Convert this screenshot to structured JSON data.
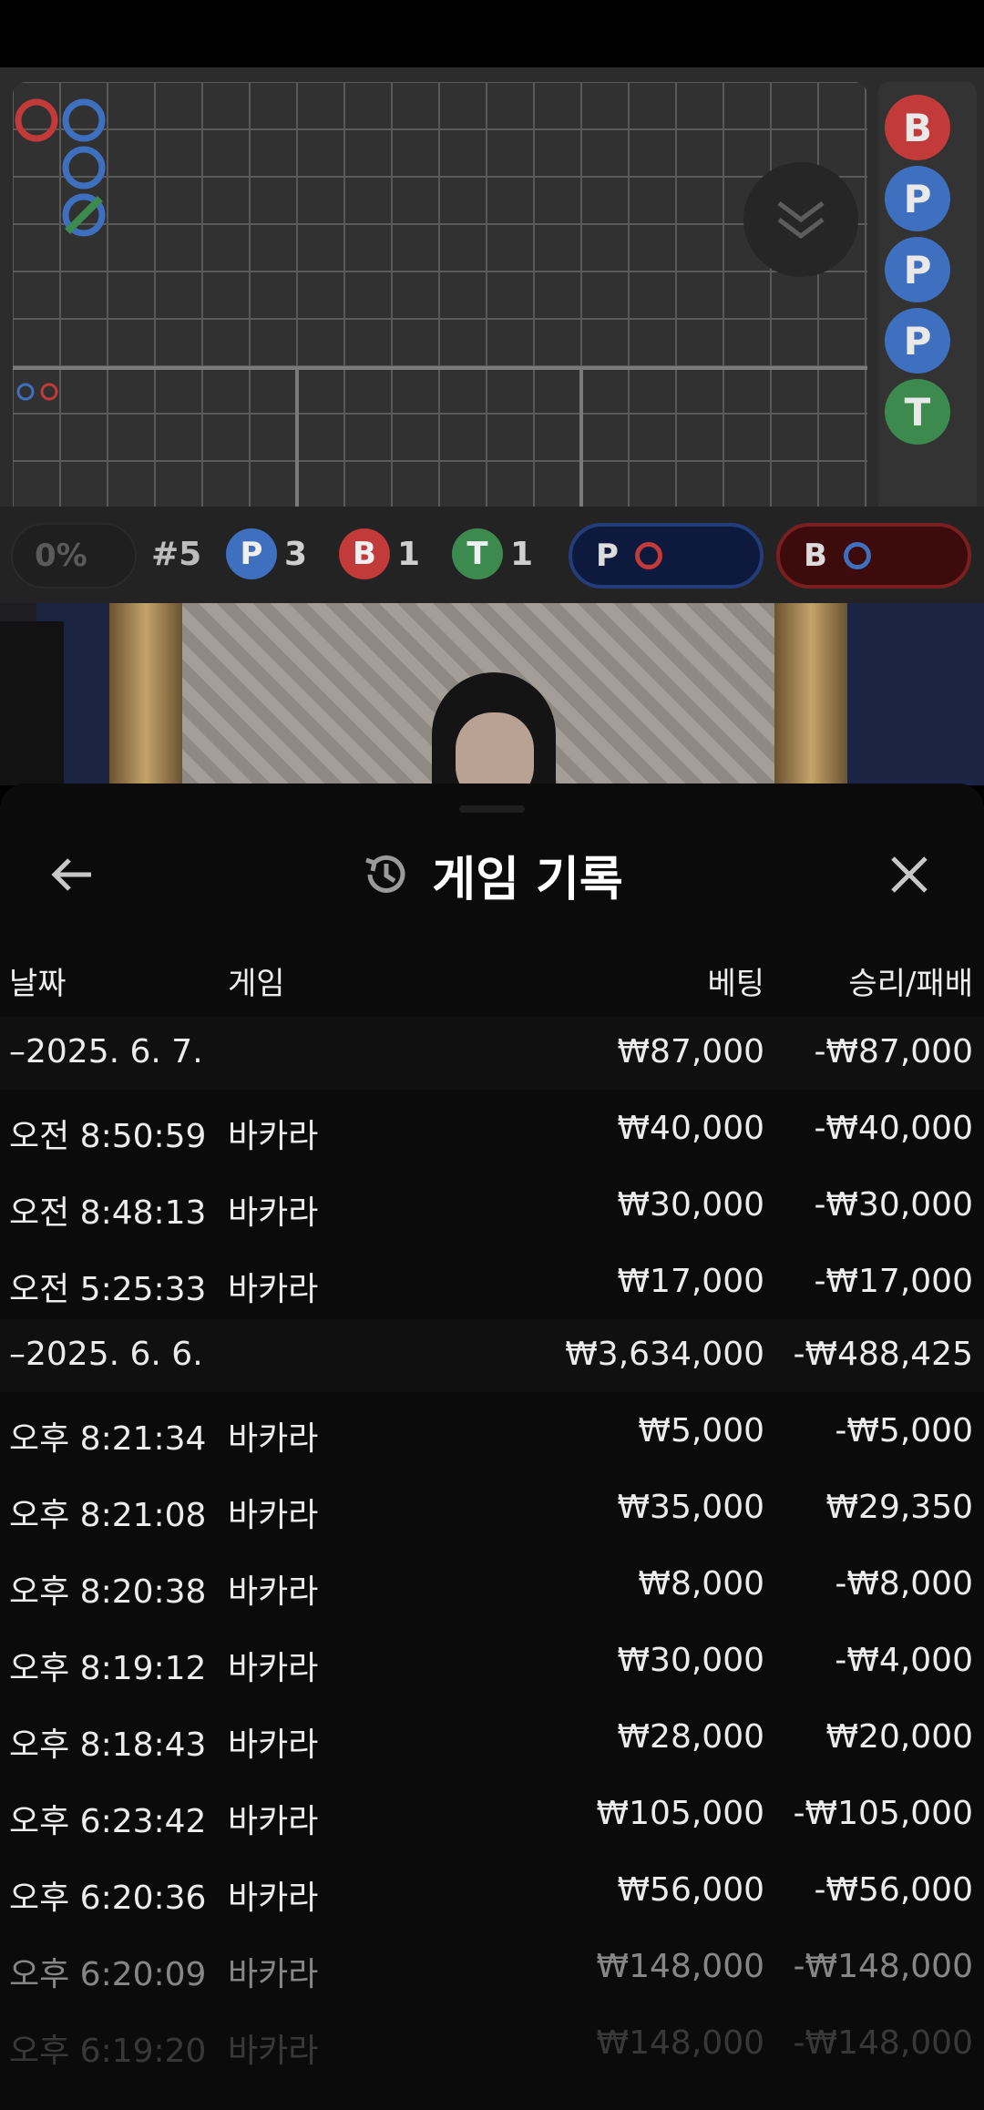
{
  "scoreboard": {
    "percent": "0%",
    "round": "#5",
    "counts": [
      {
        "letter": "P",
        "value": "3",
        "color": "#3f6fbf"
      },
      {
        "letter": "B",
        "value": "1",
        "color": "#c23a3a"
      },
      {
        "letter": "T",
        "value": "1",
        "color": "#3d8a4f"
      }
    ],
    "predict_player": "P",
    "predict_banker": "B",
    "next_results": [
      {
        "letter": "B",
        "color": "#c23a3a"
      },
      {
        "letter": "P",
        "color": "#3f6fbf"
      },
      {
        "letter": "P",
        "color": "#3f6fbf"
      },
      {
        "letter": "P",
        "color": "#3f6fbf"
      },
      {
        "letter": "T",
        "color": "#3d8a4f"
      }
    ]
  },
  "sheet": {
    "title": "게임 기록",
    "headers": {
      "date": "날짜",
      "game": "게임",
      "bet": "베팅",
      "result": "승리/패배"
    }
  },
  "history": [
    {
      "type": "group",
      "date": "–2025. 6. 7.",
      "game": "",
      "bet": "₩87,000",
      "result": "-₩87,000"
    },
    {
      "type": "item",
      "date": "오전 8:50:59",
      "game": "바카라",
      "bet": "₩40,000",
      "result": "-₩40,000"
    },
    {
      "type": "item",
      "date": "오전 8:48:13",
      "game": "바카라",
      "bet": "₩30,000",
      "result": "-₩30,000"
    },
    {
      "type": "item",
      "date": "오전 5:25:33",
      "game": "바카라",
      "bet": "₩17,000",
      "result": "-₩17,000"
    },
    {
      "type": "group",
      "date": "–2025. 6. 6.",
      "game": "",
      "bet": "₩3,634,000",
      "result": "-₩488,425"
    },
    {
      "type": "item",
      "date": "오후 8:21:34",
      "game": "바카라",
      "bet": "₩5,000",
      "result": "-₩5,000"
    },
    {
      "type": "item",
      "date": "오후 8:21:08",
      "game": "바카라",
      "bet": "₩35,000",
      "result": "₩29,350"
    },
    {
      "type": "item",
      "date": "오후 8:20:38",
      "game": "바카라",
      "bet": "₩8,000",
      "result": "-₩8,000"
    },
    {
      "type": "item",
      "date": "오후 8:19:12",
      "game": "바카라",
      "bet": "₩30,000",
      "result": "-₩4,000"
    },
    {
      "type": "item",
      "date": "오후 8:18:43",
      "game": "바카라",
      "bet": "₩28,000",
      "result": "₩20,000"
    },
    {
      "type": "item",
      "date": "오후 6:23:42",
      "game": "바카라",
      "bet": "₩105,000",
      "result": "-₩105,000"
    },
    {
      "type": "item",
      "date": "오후 6:20:36",
      "game": "바카라",
      "bet": "₩56,000",
      "result": "-₩56,000"
    },
    {
      "type": "item",
      "date": "오후 6:20:09",
      "game": "바카라",
      "bet": "₩148,000",
      "result": "-₩148,000"
    },
    {
      "type": "item",
      "date": "오후 6:19:20",
      "game": "바카라",
      "bet": "₩148,000",
      "result": "-₩148,000"
    }
  ]
}
